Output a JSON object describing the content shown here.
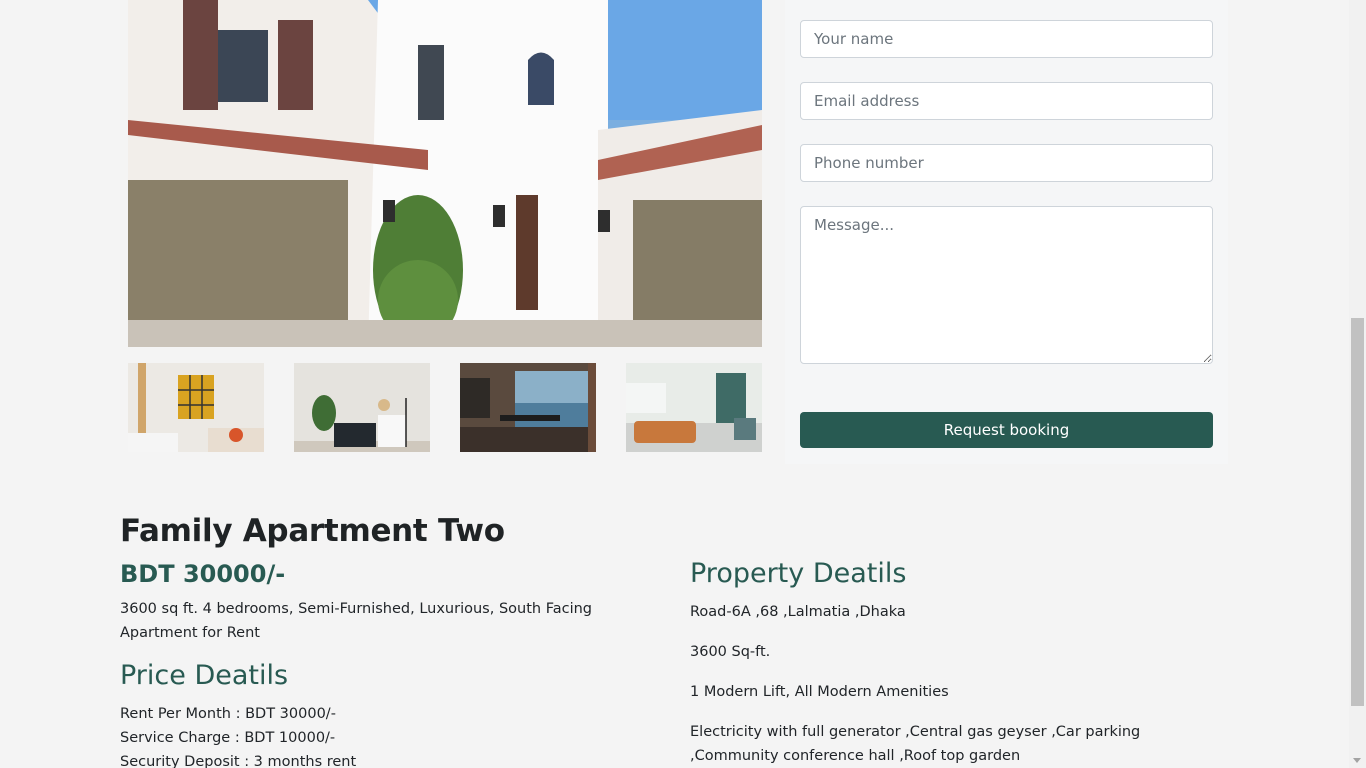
{
  "gallery": {
    "main_image": "house-exterior-image",
    "thumbnails": [
      {
        "name": "living-room-image"
      },
      {
        "name": "bedroom-image"
      },
      {
        "name": "dining-room-image"
      },
      {
        "name": "lounge-image"
      }
    ]
  },
  "booking_form": {
    "name_placeholder": "Your name",
    "email_placeholder": "Email address",
    "phone_placeholder": "Phone number",
    "message_placeholder": "Message...",
    "submit_label": "Request booking"
  },
  "listing": {
    "title": "Family Apartment Two",
    "price": "BDT 30000/-",
    "summary": "3600 sq ft. 4 bedrooms, Semi-Furnished, Luxurious, South Facing Apartment for Rent",
    "price_details": {
      "heading": "Price Deatils",
      "lines": [
        "Rent Per Month : BDT 30000/-",
        "Service Charge : BDT 10000/-",
        "Security Deposit : 3 months rent"
      ]
    },
    "property_details": {
      "heading": "Property Deatils",
      "lines": [
        "Road-6A ,68 ,Lalmatia ,Dhaka",
        "3600 Sq-ft.",
        "1 Modern Lift, All Modern Amenities",
        "Electricity with full generator ,Central gas geyser ,Car parking ,Community conference hall ,Roof top garden"
      ]
    }
  },
  "colors": {
    "accent": "#285a52",
    "page_background": "#f4f4f4"
  }
}
